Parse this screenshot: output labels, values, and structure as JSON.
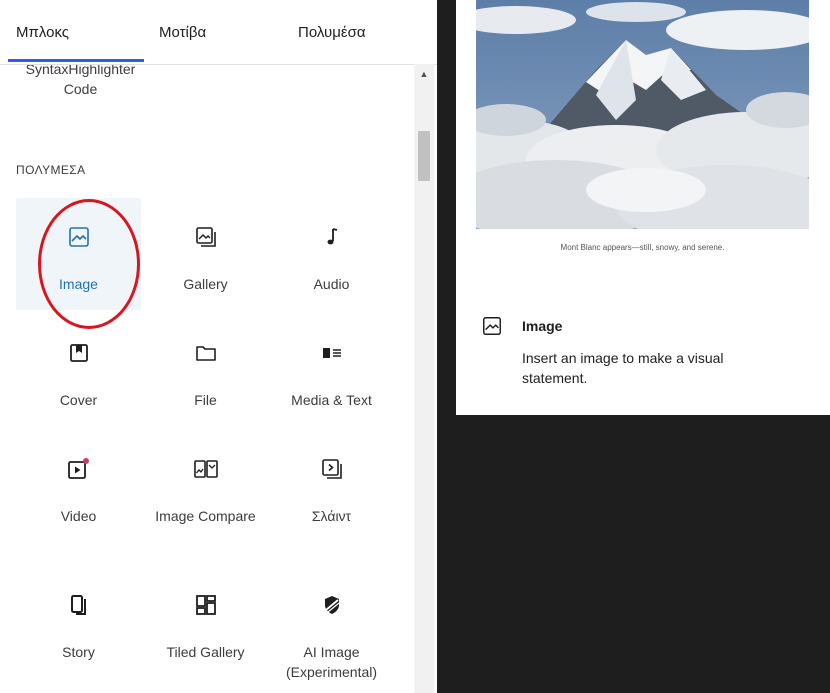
{
  "tabs": [
    {
      "label": "Μπλοκς"
    },
    {
      "label": "Μοτίβα"
    },
    {
      "label": "Πολυμέσα"
    }
  ],
  "partial_block_label": "SyntaxHighlighter Code",
  "section_title": "ΠΟΛΥΜΕΣΑ",
  "blocks": [
    {
      "label": "Image",
      "icon": "image-icon",
      "active": true
    },
    {
      "label": "Gallery",
      "icon": "gallery-icon"
    },
    {
      "label": "Audio",
      "icon": "audio-icon"
    },
    {
      "label": "Cover",
      "icon": "cover-icon"
    },
    {
      "label": "File",
      "icon": "file-icon"
    },
    {
      "label": "Media & Text",
      "icon": "media-text-icon"
    },
    {
      "label": "Video",
      "icon": "video-icon"
    },
    {
      "label": "Image Compare",
      "icon": "image-compare-icon"
    },
    {
      "label": "Σλάιντ",
      "icon": "slideshow-icon"
    },
    {
      "label": "Story",
      "icon": "story-icon"
    },
    {
      "label": "Tiled Gallery",
      "icon": "tiled-gallery-icon"
    },
    {
      "label": "AI Image (Experimental)",
      "icon": "ai-image-icon"
    }
  ],
  "preview": {
    "caption": "Mont Blanc appears—still, snowy, and serene.",
    "title": "Image",
    "description": "Insert an image to make a visual statement."
  },
  "colors": {
    "accent": "#3858e9",
    "active_text": "#2271b1",
    "active_bg": "#f0f5fa",
    "highlight_ring": "#d9161f",
    "dark_canvas": "#1e1e1e",
    "video_dot": "#d63666"
  }
}
